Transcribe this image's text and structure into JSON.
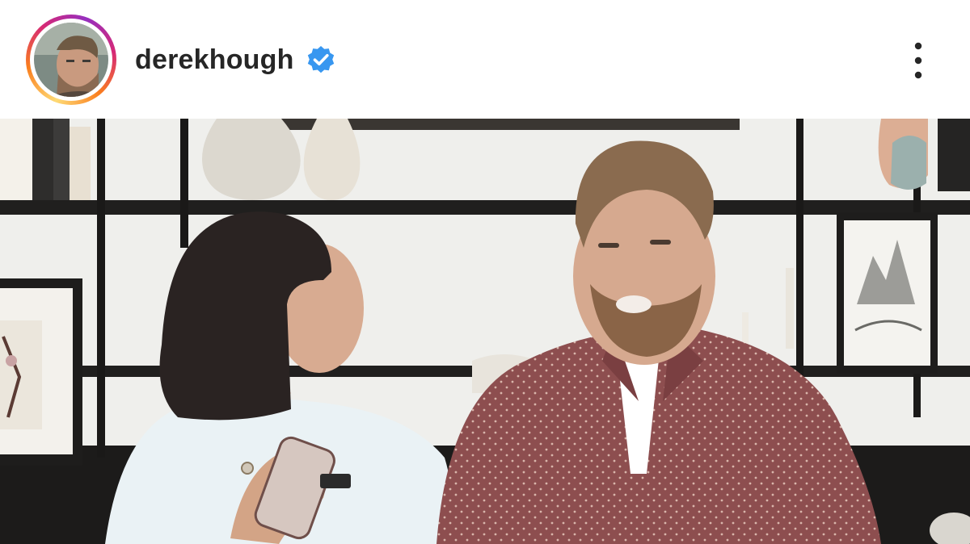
{
  "post": {
    "username": "derekhough",
    "verified": true,
    "icons": {
      "verified": "verified-badge-icon",
      "more": "more-options-icon"
    },
    "colors": {
      "verified_badge": "#3897f0",
      "username_text": "#262626",
      "story_ring": [
        "#feda75",
        "#fa7e1e",
        "#d62976",
        "#962fbf"
      ]
    },
    "media": {
      "type": "video-frame"
    }
  }
}
